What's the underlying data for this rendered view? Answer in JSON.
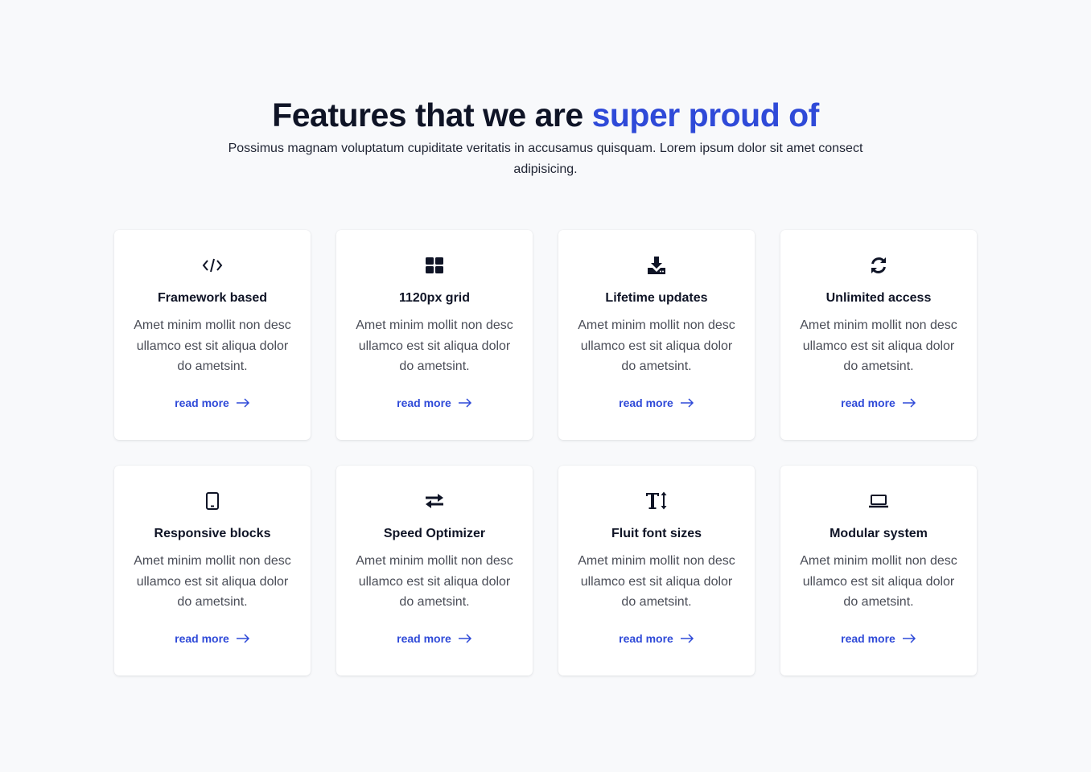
{
  "header": {
    "title_part1": "Features that we are ",
    "title_accent": "super proud of",
    "subtitle": "Possimus magnam voluptatum cupiditate veritatis in accusamus quisquam. Lorem ipsum dolor sit amet consect adipisicing."
  },
  "colors": {
    "accent": "#2f4ad8",
    "text": "#0f1426",
    "background": "#f8f9fb",
    "card": "#ffffff"
  },
  "features": [
    {
      "icon": "code-icon",
      "title": "Framework based",
      "desc": "Amet minim mollit non desc ullamco est sit aliqua dolor do ametsint.",
      "link": "read more"
    },
    {
      "icon": "grid-icon",
      "title": "1120px grid",
      "desc": "Amet minim mollit non desc ullamco est sit aliqua dolor do ametsint.",
      "link": "read more"
    },
    {
      "icon": "download-icon",
      "title": "Lifetime updates",
      "desc": "Amet minim mollit non desc ullamco est sit aliqua dolor do ametsint.",
      "link": "read more"
    },
    {
      "icon": "refresh-icon",
      "title": "Unlimited access",
      "desc": "Amet minim mollit non desc ullamco est sit aliqua dolor do ametsint.",
      "link": "read more"
    },
    {
      "icon": "tablet-icon",
      "title": "Responsive blocks",
      "desc": "Amet minim mollit non desc ullamco est sit aliqua dolor do ametsint.",
      "link": "read more"
    },
    {
      "icon": "exchange-icon",
      "title": "Speed Optimizer",
      "desc": "Amet minim mollit non desc ullamco est sit aliqua dolor do ametsint.",
      "link": "read more"
    },
    {
      "icon": "text-height-icon",
      "title": "Fluit font sizes",
      "desc": "Amet minim mollit non desc ullamco est sit aliqua dolor do ametsint.",
      "link": "read more"
    },
    {
      "icon": "laptop-icon",
      "title": "Modular system",
      "desc": "Amet minim mollit non desc ullamco est sit aliqua dolor do ametsint.",
      "link": "read more"
    }
  ]
}
